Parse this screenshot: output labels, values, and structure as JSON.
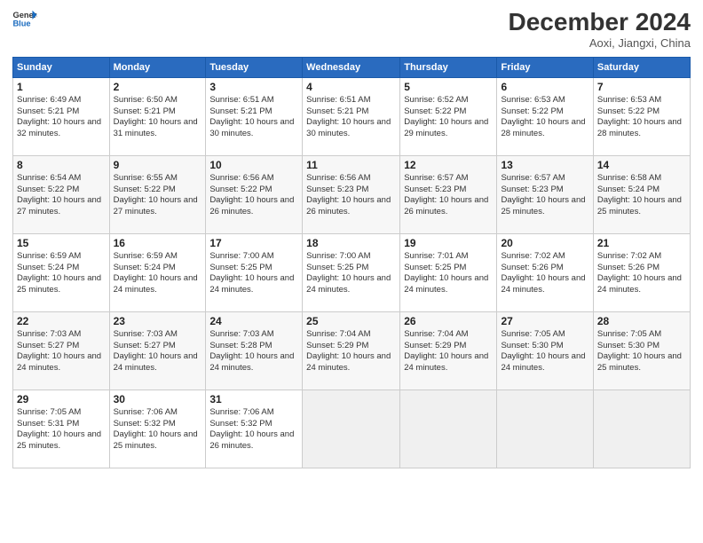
{
  "header": {
    "logo_line1": "General",
    "logo_line2": "Blue",
    "month": "December 2024",
    "location": "Aoxi, Jiangxi, China"
  },
  "weekdays": [
    "Sunday",
    "Monday",
    "Tuesday",
    "Wednesday",
    "Thursday",
    "Friday",
    "Saturday"
  ],
  "weeks": [
    [
      {
        "day": "1",
        "sunrise": "6:49 AM",
        "sunset": "5:21 PM",
        "daylight": "10 hours and 32 minutes."
      },
      {
        "day": "2",
        "sunrise": "6:50 AM",
        "sunset": "5:21 PM",
        "daylight": "10 hours and 31 minutes."
      },
      {
        "day": "3",
        "sunrise": "6:51 AM",
        "sunset": "5:21 PM",
        "daylight": "10 hours and 30 minutes."
      },
      {
        "day": "4",
        "sunrise": "6:51 AM",
        "sunset": "5:21 PM",
        "daylight": "10 hours and 30 minutes."
      },
      {
        "day": "5",
        "sunrise": "6:52 AM",
        "sunset": "5:22 PM",
        "daylight": "10 hours and 29 minutes."
      },
      {
        "day": "6",
        "sunrise": "6:53 AM",
        "sunset": "5:22 PM",
        "daylight": "10 hours and 28 minutes."
      },
      {
        "day": "7",
        "sunrise": "6:53 AM",
        "sunset": "5:22 PM",
        "daylight": "10 hours and 28 minutes."
      }
    ],
    [
      {
        "day": "8",
        "sunrise": "6:54 AM",
        "sunset": "5:22 PM",
        "daylight": "10 hours and 27 minutes."
      },
      {
        "day": "9",
        "sunrise": "6:55 AM",
        "sunset": "5:22 PM",
        "daylight": "10 hours and 27 minutes."
      },
      {
        "day": "10",
        "sunrise": "6:56 AM",
        "sunset": "5:22 PM",
        "daylight": "10 hours and 26 minutes."
      },
      {
        "day": "11",
        "sunrise": "6:56 AM",
        "sunset": "5:23 PM",
        "daylight": "10 hours and 26 minutes."
      },
      {
        "day": "12",
        "sunrise": "6:57 AM",
        "sunset": "5:23 PM",
        "daylight": "10 hours and 26 minutes."
      },
      {
        "day": "13",
        "sunrise": "6:57 AM",
        "sunset": "5:23 PM",
        "daylight": "10 hours and 25 minutes."
      },
      {
        "day": "14",
        "sunrise": "6:58 AM",
        "sunset": "5:24 PM",
        "daylight": "10 hours and 25 minutes."
      }
    ],
    [
      {
        "day": "15",
        "sunrise": "6:59 AM",
        "sunset": "5:24 PM",
        "daylight": "10 hours and 25 minutes."
      },
      {
        "day": "16",
        "sunrise": "6:59 AM",
        "sunset": "5:24 PM",
        "daylight": "10 hours and 24 minutes."
      },
      {
        "day": "17",
        "sunrise": "7:00 AM",
        "sunset": "5:25 PM",
        "daylight": "10 hours and 24 minutes."
      },
      {
        "day": "18",
        "sunrise": "7:00 AM",
        "sunset": "5:25 PM",
        "daylight": "10 hours and 24 minutes."
      },
      {
        "day": "19",
        "sunrise": "7:01 AM",
        "sunset": "5:25 PM",
        "daylight": "10 hours and 24 minutes."
      },
      {
        "day": "20",
        "sunrise": "7:02 AM",
        "sunset": "5:26 PM",
        "daylight": "10 hours and 24 minutes."
      },
      {
        "day": "21",
        "sunrise": "7:02 AM",
        "sunset": "5:26 PM",
        "daylight": "10 hours and 24 minutes."
      }
    ],
    [
      {
        "day": "22",
        "sunrise": "7:03 AM",
        "sunset": "5:27 PM",
        "daylight": "10 hours and 24 minutes."
      },
      {
        "day": "23",
        "sunrise": "7:03 AM",
        "sunset": "5:27 PM",
        "daylight": "10 hours and 24 minutes."
      },
      {
        "day": "24",
        "sunrise": "7:03 AM",
        "sunset": "5:28 PM",
        "daylight": "10 hours and 24 minutes."
      },
      {
        "day": "25",
        "sunrise": "7:04 AM",
        "sunset": "5:29 PM",
        "daylight": "10 hours and 24 minutes."
      },
      {
        "day": "26",
        "sunrise": "7:04 AM",
        "sunset": "5:29 PM",
        "daylight": "10 hours and 24 minutes."
      },
      {
        "day": "27",
        "sunrise": "7:05 AM",
        "sunset": "5:30 PM",
        "daylight": "10 hours and 24 minutes."
      },
      {
        "day": "28",
        "sunrise": "7:05 AM",
        "sunset": "5:30 PM",
        "daylight": "10 hours and 25 minutes."
      }
    ],
    [
      {
        "day": "29",
        "sunrise": "7:05 AM",
        "sunset": "5:31 PM",
        "daylight": "10 hours and 25 minutes."
      },
      {
        "day": "30",
        "sunrise": "7:06 AM",
        "sunset": "5:32 PM",
        "daylight": "10 hours and 25 minutes."
      },
      {
        "day": "31",
        "sunrise": "7:06 AM",
        "sunset": "5:32 PM",
        "daylight": "10 hours and 26 minutes."
      },
      null,
      null,
      null,
      null
    ]
  ]
}
